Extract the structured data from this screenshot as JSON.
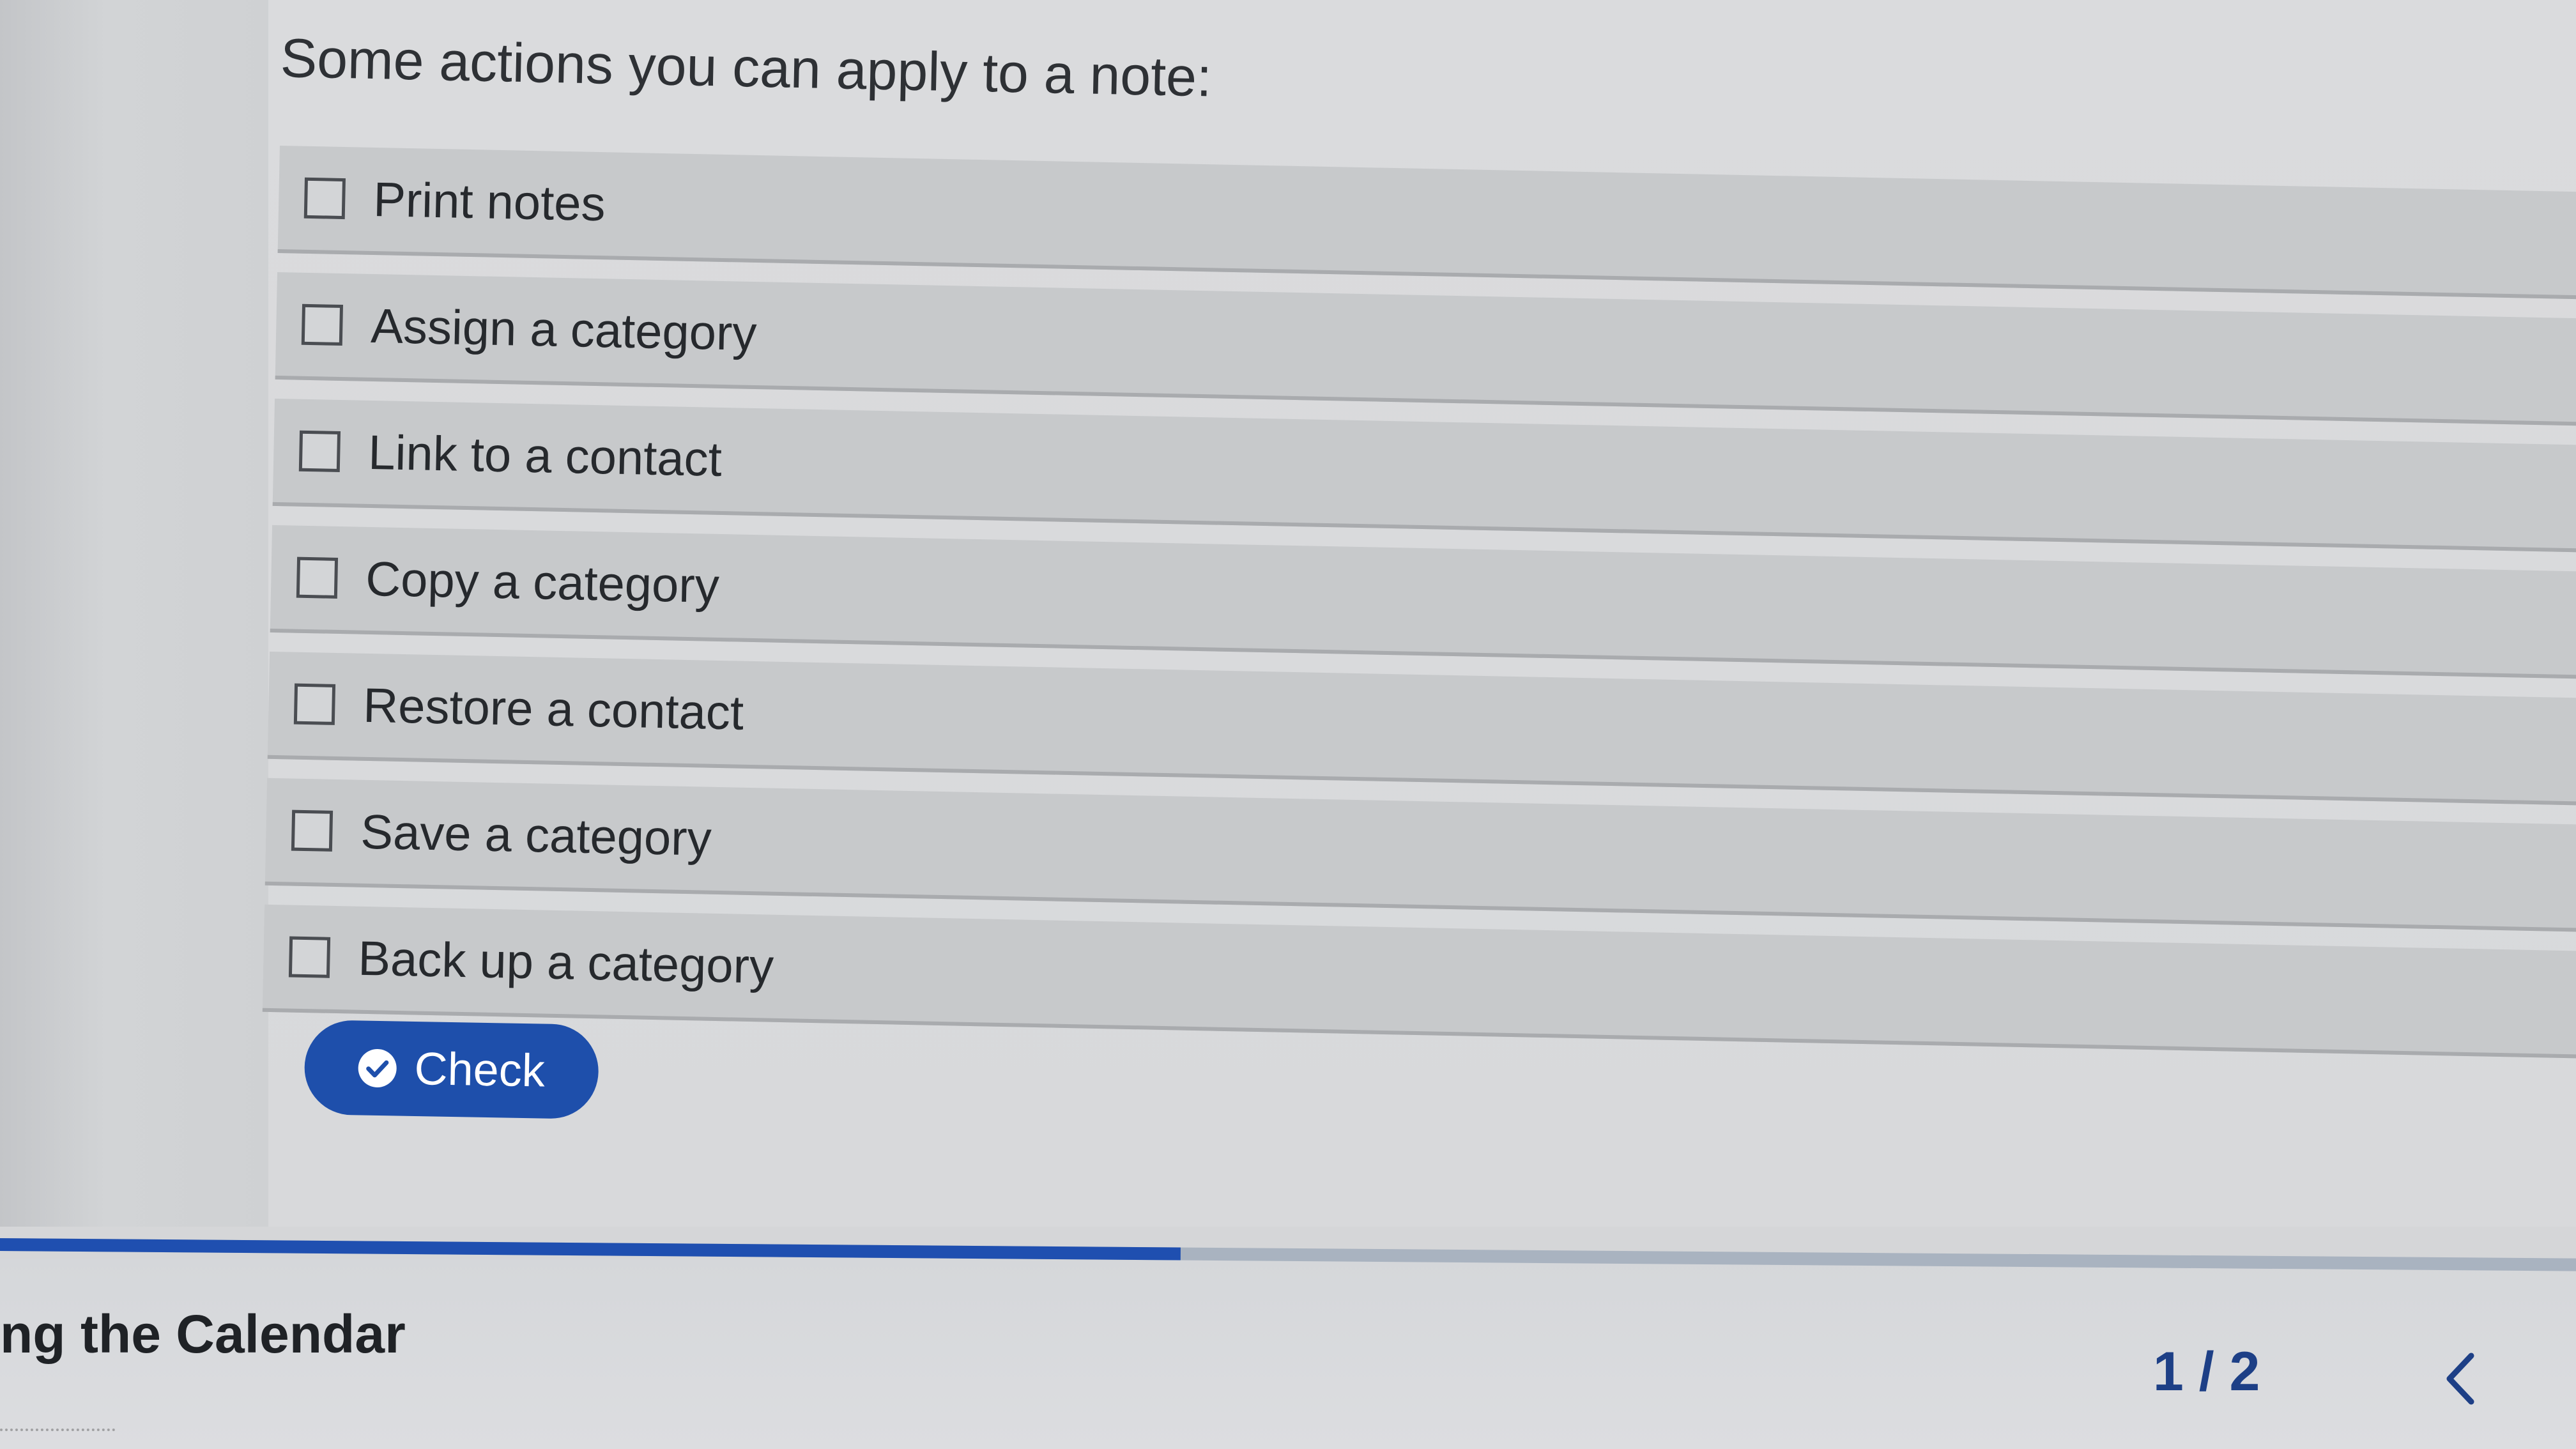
{
  "question": {
    "prompt": "Some actions you can apply to a note:"
  },
  "options": [
    {
      "label": "Print notes",
      "checked": false
    },
    {
      "label": "Assign a category",
      "checked": false
    },
    {
      "label": "Link to a contact",
      "checked": false
    },
    {
      "label": "Copy a category",
      "checked": false
    },
    {
      "label": "Restore a contact",
      "checked": false
    },
    {
      "label": "Save a category",
      "checked": false
    },
    {
      "label": "Back up a category",
      "checked": false
    }
  ],
  "check_button": {
    "label": "Check",
    "icon": "check-circle-icon"
  },
  "progress": {
    "fraction": 0.44
  },
  "footer": {
    "chapter_title": "ng the Calendar",
    "page_indicator": "1 / 2",
    "prev_icon": "chevron-left-icon"
  },
  "colors": {
    "accent": "#1e4fab",
    "progress_fill": "#1f4fb0",
    "progress_track": "#a9b3c0",
    "option_background": "#c7c9cb",
    "page_indicator": "#1d3f86"
  }
}
